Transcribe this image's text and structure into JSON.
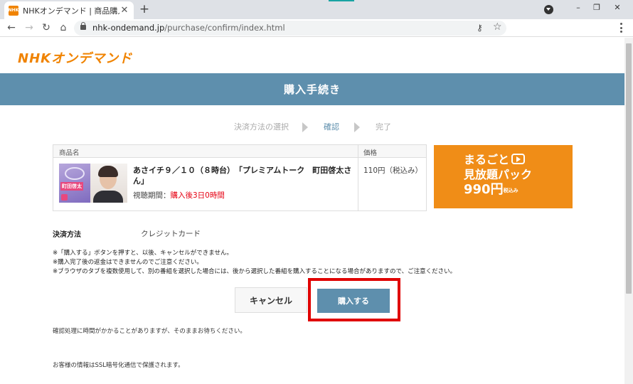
{
  "browser": {
    "tab_title": "NHKオンデマンド | 商品購入確認",
    "favicon_text": "NHK",
    "new_tab": "+",
    "url_domain": "nhk-ondemand.jp",
    "url_path": "/purchase/confirm/index.html",
    "icons": {
      "back": "arrow-left",
      "forward": "arrow-right",
      "reload": "reload",
      "home": "home",
      "lock": "lock",
      "key": "key",
      "star": "star",
      "menu": "kebab-menu",
      "profile": "profile"
    }
  },
  "page": {
    "logo": "NHKオンデマンド",
    "title": "購入手続き",
    "steps": [
      {
        "label": "決済方法の選択",
        "active": false
      },
      {
        "label": "確認",
        "active": true
      },
      {
        "label": "完了",
        "active": false
      }
    ],
    "table": {
      "col_product": "商品名",
      "col_price": "価格",
      "thumb_label": "町田啓太",
      "product_title": "あさイチ９／１０（８時台）　「プレミアムトーク　町田啓太さん」",
      "period_label": "視聴期間：",
      "period_value": "購入後3日0時間",
      "price": "110円（税込み）"
    },
    "ad": {
      "line1": "まるごと",
      "line2": "見放題パック",
      "price": "990円",
      "tax": "税込み"
    },
    "payment": {
      "label": "決済方法",
      "value": "クレジットカード"
    },
    "notes": [
      "※「購入する」ボタンを押すと、以後、キャンセルができません。",
      "※購入完了後の返金はできませんのでご注意ください。",
      "※ブラウザのタブを複数使用して、別の番組を選択した場合には、後から選択した番組を購入することになる場合がありますので、ご注意ください。"
    ],
    "buttons": {
      "cancel": "キャンセル",
      "buy": "購入する"
    },
    "wait_message": "確認処理に時間がかかることがありますが、そのままお待ちください。",
    "ssl_message": "お客様の情報はSSL暗号化通信で保護されます。",
    "colors": {
      "brand_orange": "#f08300",
      "header_blue": "#5e8fad",
      "alert_red": "#e60012",
      "highlight_red": "#e00000"
    }
  }
}
